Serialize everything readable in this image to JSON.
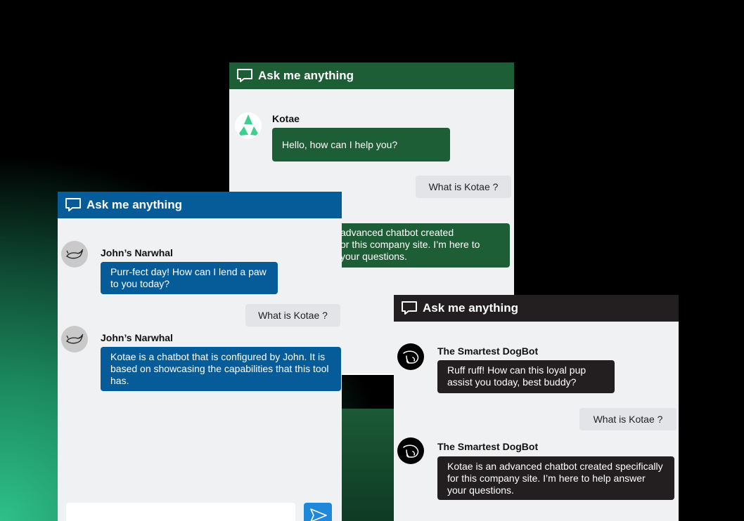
{
  "colors": {
    "green": "#1e5e36",
    "blue": "#065c99",
    "dark": "#231f20"
  },
  "green_window": {
    "title": "Ask me anything",
    "bot_name": "Kotae",
    "greeting": "Hello, how can I help you?",
    "user_question": "What is Kotae ?",
    "answer_line1": "advanced chatbot created",
    "answer_line2": "or this company site. I’m here to",
    "answer_line3": "your questions."
  },
  "blue_window": {
    "title": "Ask me anything",
    "bot_name": "John’s Narwhal",
    "greeting": "Purr-fect day! How can I lend a paw to you today?",
    "user_question": "What is Kotae ?",
    "answer": "Kotae is a chatbot that is configured by John. It is based on showcasing the capabilities that this tool has.",
    "input_value": ""
  },
  "dark_window": {
    "title": "Ask me anything",
    "bot_name": "The Smartest DogBot",
    "greeting": "Ruff ruff! How can this loyal pup assist you today, best buddy?",
    "user_question": "What is Kotae ?",
    "answer": "Kotae is an advanced chatbot created specifically for this company site. I’m here to help answer your questions."
  }
}
